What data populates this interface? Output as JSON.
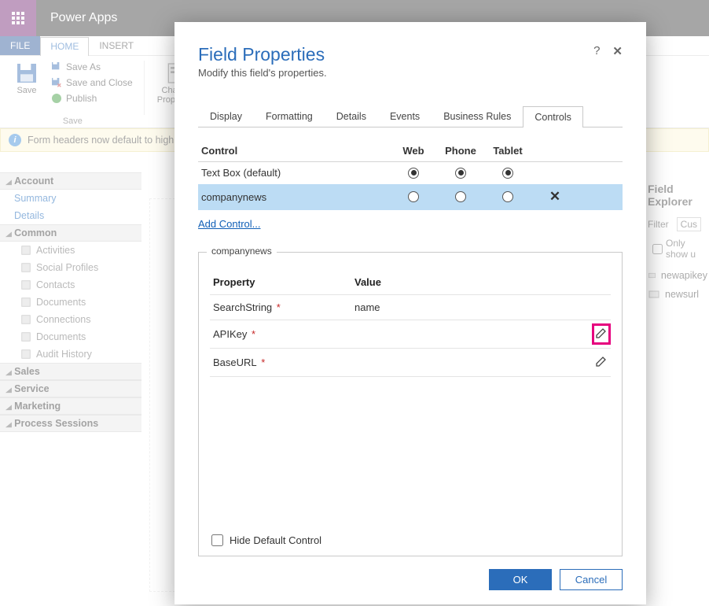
{
  "app": {
    "title": "Power Apps"
  },
  "ribbonTabs": {
    "file": "FILE",
    "home": "HOME",
    "insert": "INSERT"
  },
  "ribbon": {
    "save_big": "Save",
    "saveas": "Save As",
    "saveclose": "Save and Close",
    "publish": "Publish",
    "group_save": "Save",
    "changeprops": "Change\nProperties"
  },
  "msgbar": {
    "text": "Form headers now default to high dens"
  },
  "leftnav": {
    "sections": [
      {
        "title": "Account",
        "items": [
          {
            "label": "Summary",
            "link": true
          },
          {
            "label": "Details",
            "link": true
          }
        ]
      },
      {
        "title": "Common",
        "items": [
          {
            "label": "Activities"
          },
          {
            "label": "Social Profiles"
          },
          {
            "label": "Contacts"
          },
          {
            "label": "Documents"
          },
          {
            "label": "Connections"
          },
          {
            "label": "Documents"
          },
          {
            "label": "Audit History"
          }
        ]
      },
      {
        "title": "Sales",
        "items": []
      },
      {
        "title": "Service",
        "items": []
      },
      {
        "title": "Marketing",
        "items": []
      },
      {
        "title": "Process Sessions",
        "items": []
      }
    ]
  },
  "explorer": {
    "title": "Field Explorer",
    "filter_label": "Filter",
    "filter_value": "Cus",
    "onlyshow": "Only show u",
    "items": [
      "newapikey",
      "newsurl"
    ]
  },
  "modal": {
    "title": "Field Properties",
    "subtitle": "Modify this field's properties.",
    "help": "?",
    "close": "✕",
    "tabs": [
      "Display",
      "Formatting",
      "Details",
      "Events",
      "Business Rules",
      "Controls"
    ],
    "activeTab": 5,
    "controlTable": {
      "headers": [
        "Control",
        "Web",
        "Phone",
        "Tablet"
      ],
      "rows": [
        {
          "name": "Text Box (default)",
          "web": true,
          "phone": true,
          "tablet": true,
          "selected": false,
          "removable": false
        },
        {
          "name": "companynews",
          "web": false,
          "phone": false,
          "tablet": false,
          "selected": true,
          "removable": true
        }
      ],
      "addControl": "Add Control..."
    },
    "propBox": {
      "legend": "companynews",
      "headers": [
        "Property",
        "Value"
      ],
      "rows": [
        {
          "name": "SearchString",
          "required": true,
          "value": "name",
          "edit_highlight": false
        },
        {
          "name": "APIKey",
          "required": true,
          "value": "",
          "edit_highlight": true
        },
        {
          "name": "BaseURL",
          "required": true,
          "value": "",
          "edit_highlight": false
        }
      ],
      "hideDefault": "Hide Default Control"
    },
    "buttons": {
      "ok": "OK",
      "cancel": "Cancel"
    }
  }
}
